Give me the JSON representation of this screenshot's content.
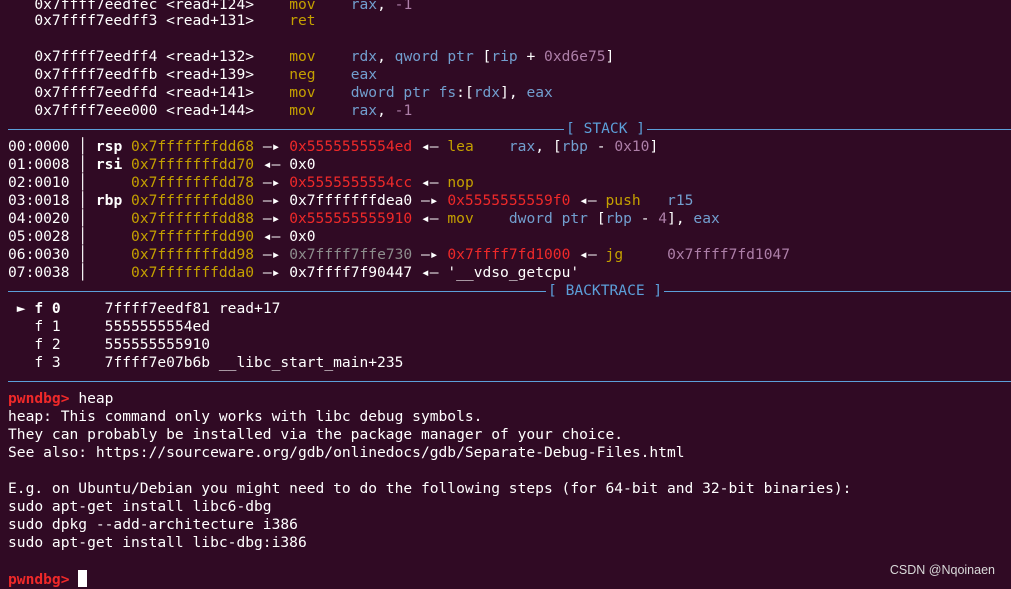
{
  "disasm": [
    {
      "addr": "0x7ffff7eedfec",
      "sym": "<read+124>",
      "mn": "mov",
      "ops": [
        {
          "t": "rax",
          "c": "blue"
        },
        {
          "t": ", ",
          "c": "white"
        },
        {
          "t": "-1",
          "c": "purple"
        }
      ]
    },
    {
      "addr": "0x7ffff7eedff3",
      "sym": "<read+131>",
      "mn": "ret",
      "ops": []
    },
    {
      "addr": "",
      "sym": "",
      "mn": "",
      "ops": []
    },
    {
      "addr": "0x7ffff7eedff4",
      "sym": "<read+132>",
      "mn": "mov",
      "ops": [
        {
          "t": "rdx",
          "c": "blue"
        },
        {
          "t": ", ",
          "c": "white"
        },
        {
          "t": "qword ptr",
          "c": "blue"
        },
        {
          "t": " [",
          "c": "white"
        },
        {
          "t": "rip",
          "c": "blue"
        },
        {
          "t": " + ",
          "c": "white"
        },
        {
          "t": "0xd6e75",
          "c": "purple"
        },
        {
          "t": "]",
          "c": "white"
        }
      ]
    },
    {
      "addr": "0x7ffff7eedffb",
      "sym": "<read+139>",
      "mn": "neg",
      "ops": [
        {
          "t": "eax",
          "c": "blue"
        }
      ]
    },
    {
      "addr": "0x7ffff7eedffd",
      "sym": "<read+141>",
      "mn": "mov",
      "ops": [
        {
          "t": "dword ptr fs",
          "c": "blue"
        },
        {
          "t": ":[",
          "c": "white"
        },
        {
          "t": "rdx",
          "c": "blue"
        },
        {
          "t": "], ",
          "c": "white"
        },
        {
          "t": "eax",
          "c": "blue"
        }
      ]
    },
    {
      "addr": "0x7ffff7eee000",
      "sym": "<read+144>",
      "mn": "mov",
      "ops": [
        {
          "t": "rax",
          "c": "blue"
        },
        {
          "t": ", ",
          "c": "white"
        },
        {
          "t": "-1",
          "c": "purple"
        }
      ]
    }
  ],
  "stack_title": "[ STACK ]",
  "stack": [
    {
      "idx": "00:0000",
      "reg": "rsp",
      "segs": [
        {
          "t": "0x7fffffffdd68",
          "c": "yellow"
        },
        {
          "t": " —▸ ",
          "c": "white"
        },
        {
          "t": "0x5555555554ed",
          "c": "red"
        },
        {
          "t": " ◂— ",
          "c": "white"
        },
        {
          "t": "lea",
          "c": "yellow"
        },
        {
          "t": "    ",
          "c": "white"
        },
        {
          "t": "rax",
          "c": "blue"
        },
        {
          "t": ", [",
          "c": "white"
        },
        {
          "t": "rbp",
          "c": "blue"
        },
        {
          "t": " - ",
          "c": "white"
        },
        {
          "t": "0x10",
          "c": "purple"
        },
        {
          "t": "]",
          "c": "white"
        }
      ]
    },
    {
      "idx": "01:0008",
      "reg": "rsi",
      "segs": [
        {
          "t": "0x7fffffffdd70",
          "c": "yellow"
        },
        {
          "t": " ◂— 0x0",
          "c": "white"
        }
      ]
    },
    {
      "idx": "02:0010",
      "reg": "",
      "segs": [
        {
          "t": "0x7fffffffdd78",
          "c": "yellow"
        },
        {
          "t": " —▸ ",
          "c": "white"
        },
        {
          "t": "0x5555555554cc",
          "c": "red"
        },
        {
          "t": " ◂— ",
          "c": "white"
        },
        {
          "t": "nop",
          "c": "yellow"
        }
      ]
    },
    {
      "idx": "03:0018",
      "reg": "rbp",
      "segs": [
        {
          "t": "0x7fffffffdd80",
          "c": "yellow"
        },
        {
          "t": " —▸ 0x7fffffffdea0 —▸ ",
          "c": "white"
        },
        {
          "t": "0x5555555559f0",
          "c": "red"
        },
        {
          "t": " ◂— ",
          "c": "white"
        },
        {
          "t": "push",
          "c": "yellow"
        },
        {
          "t": "   ",
          "c": "white"
        },
        {
          "t": "r15",
          "c": "blue"
        }
      ]
    },
    {
      "idx": "04:0020",
      "reg": "",
      "segs": [
        {
          "t": "0x7fffffffdd88",
          "c": "yellow"
        },
        {
          "t": " —▸ ",
          "c": "white"
        },
        {
          "t": "0x555555555910",
          "c": "red"
        },
        {
          "t": " ◂— ",
          "c": "white"
        },
        {
          "t": "mov",
          "c": "yellow"
        },
        {
          "t": "    ",
          "c": "white"
        },
        {
          "t": "dword ptr",
          "c": "blue"
        },
        {
          "t": " [",
          "c": "white"
        },
        {
          "t": "rbp",
          "c": "blue"
        },
        {
          "t": " - ",
          "c": "white"
        },
        {
          "t": "4",
          "c": "purple"
        },
        {
          "t": "], ",
          "c": "white"
        },
        {
          "t": "eax",
          "c": "blue"
        }
      ]
    },
    {
      "idx": "05:0028",
      "reg": "",
      "segs": [
        {
          "t": "0x7fffffffdd90",
          "c": "yellow"
        },
        {
          "t": " ◂— 0x0",
          "c": "white"
        }
      ]
    },
    {
      "idx": "06:0030",
      "reg": "",
      "segs": [
        {
          "t": "0x7fffffffdd98",
          "c": "yellow"
        },
        {
          "t": " —▸ ",
          "c": "white"
        },
        {
          "t": "0x7ffff7ffe730",
          "c": "gray"
        },
        {
          "t": " —▸ ",
          "c": "white"
        },
        {
          "t": "0x7ffff7fd1000",
          "c": "red"
        },
        {
          "t": " ◂— ",
          "c": "white"
        },
        {
          "t": "jg",
          "c": "yellow"
        },
        {
          "t": "     ",
          "c": "white"
        },
        {
          "t": "0x7ffff7fd1047",
          "c": "purple"
        }
      ]
    },
    {
      "idx": "07:0038",
      "reg": "",
      "segs": [
        {
          "t": "0x7fffffffdda0",
          "c": "yellow"
        },
        {
          "t": " —▸ 0x7ffff7f90447 ◂— '__vdso_getcpu'",
          "c": "white"
        }
      ]
    }
  ],
  "backtrace_title": "[ BACKTRACE ]",
  "backtrace": [
    {
      "marker": " ► ",
      "frame": "f 0",
      "addr": "7ffff7eedf81",
      "sym": "read+17"
    },
    {
      "marker": "   ",
      "frame": "f 1",
      "addr": "5555555554ed",
      "sym": ""
    },
    {
      "marker": "   ",
      "frame": "f 2",
      "addr": "555555555910",
      "sym": ""
    },
    {
      "marker": "   ",
      "frame": "f 3",
      "addr": "7ffff7e07b6b",
      "sym": "__libc_start_main+235"
    }
  ],
  "prompt": "pwndbg>",
  "command": "heap",
  "output": [
    "heap: This command only works with libc debug symbols.",
    "They can probably be installed via the package manager of your choice.",
    "See also: https://sourceware.org/gdb/onlinedocs/gdb/Separate-Debug-Files.html",
    "",
    "E.g. on Ubuntu/Debian you might need to do the following steps (for 64-bit and 32-bit binaries):",
    "sudo apt-get install libc6-dbg",
    "sudo dpkg --add-architecture i386",
    "sudo apt-get install libc-dbg:i386"
  ],
  "prompt2": "pwndbg>",
  "watermark": "CSDN @Nqoinaen",
  "colors": {
    "background": "#300a24",
    "text": "#ffffff",
    "address_stack": "#c4a000",
    "register": "#729fcf",
    "immediate": "#ad7fa8",
    "code_pointer": "#ef2929",
    "separator": "#5c9fd9"
  }
}
